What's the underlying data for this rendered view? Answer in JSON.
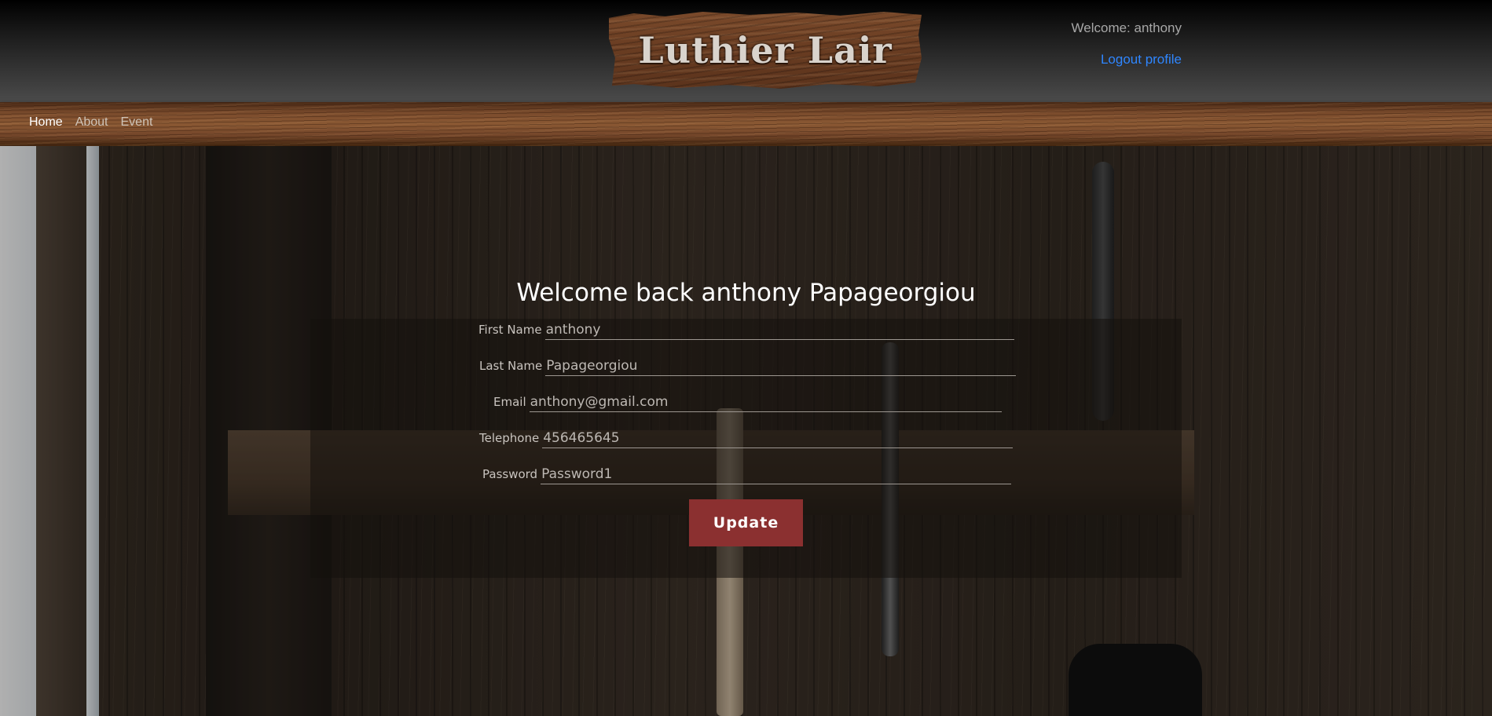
{
  "header": {
    "logo_text": "Luthier Lair",
    "welcome_text": "Welcome: anthony",
    "logout_label": "Logout profile"
  },
  "nav": {
    "items": [
      {
        "label": "Home",
        "active": true
      },
      {
        "label": "About",
        "active": false
      },
      {
        "label": "Event",
        "active": false
      }
    ]
  },
  "profile": {
    "greeting": "Welcome back anthony Papageorgiou",
    "fields": [
      {
        "label": "First Name",
        "value": "anthony"
      },
      {
        "label": "Last Name",
        "value": "Papageorgiou"
      },
      {
        "label": "Email",
        "value": "anthony@gmail.com"
      },
      {
        "label": "Telephone",
        "value": "456465645"
      },
      {
        "label": "Password",
        "value": "Password1"
      }
    ],
    "update_label": "Update"
  },
  "colors": {
    "accent_button": "#8b3030",
    "link": "#2f86ff"
  }
}
